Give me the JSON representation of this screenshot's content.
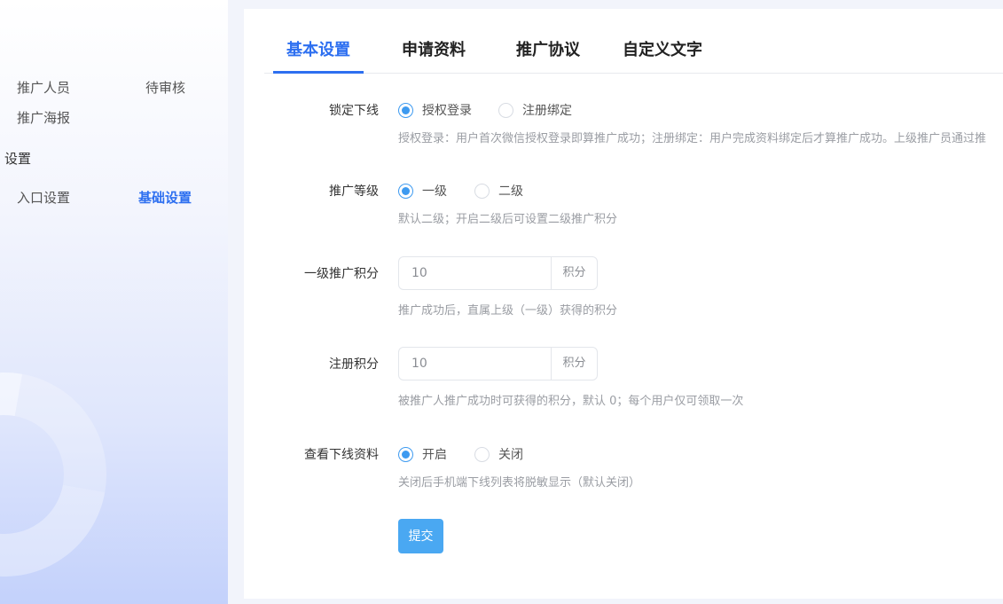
{
  "sidebar": {
    "items": [
      {
        "label": "推广人员"
      },
      {
        "label": "待审核"
      },
      {
        "label": "推广海报"
      },
      {
        "label": "入口设置"
      },
      {
        "label": "基础设置"
      }
    ],
    "group_label": "设置"
  },
  "tabs": [
    {
      "label": "基本设置",
      "active": true
    },
    {
      "label": "申请资料"
    },
    {
      "label": "推广协议"
    },
    {
      "label": "自定义文字"
    }
  ],
  "form": {
    "lock": {
      "label": "锁定下线",
      "options": [
        "授权登录",
        "注册绑定"
      ],
      "selected": "授权登录",
      "hint": "授权登录：用户首次微信授权登录即算推广成功；注册绑定：用户完成资料绑定后才算推广成功。上级推广员通过推"
    },
    "level": {
      "label": "推广等级",
      "options": [
        "一级",
        "二级"
      ],
      "selected": "一级",
      "hint": "默认二级；开启二级后可设置二级推广积分"
    },
    "level1_points": {
      "label": "一级推广积分",
      "value": "10",
      "suffix": "积分",
      "hint": "推广成功后，直属上级（一级）获得的积分"
    },
    "register_points": {
      "label": "注册积分",
      "value": "10",
      "suffix": "积分",
      "hint": "被推广人推广成功时可获得的积分，默认 0；每个用户仅可领取一次"
    },
    "view_downline": {
      "label": "查看下线资料",
      "options": [
        "开启",
        "关闭"
      ],
      "selected": "开启",
      "hint": "关闭后手机端下线列表将脱敏显示（默认关闭）"
    },
    "submit_label": "提交"
  },
  "colors": {
    "accent": "#2d6ff0",
    "radio": "#3d9af0",
    "button": "#4aa8f2"
  }
}
